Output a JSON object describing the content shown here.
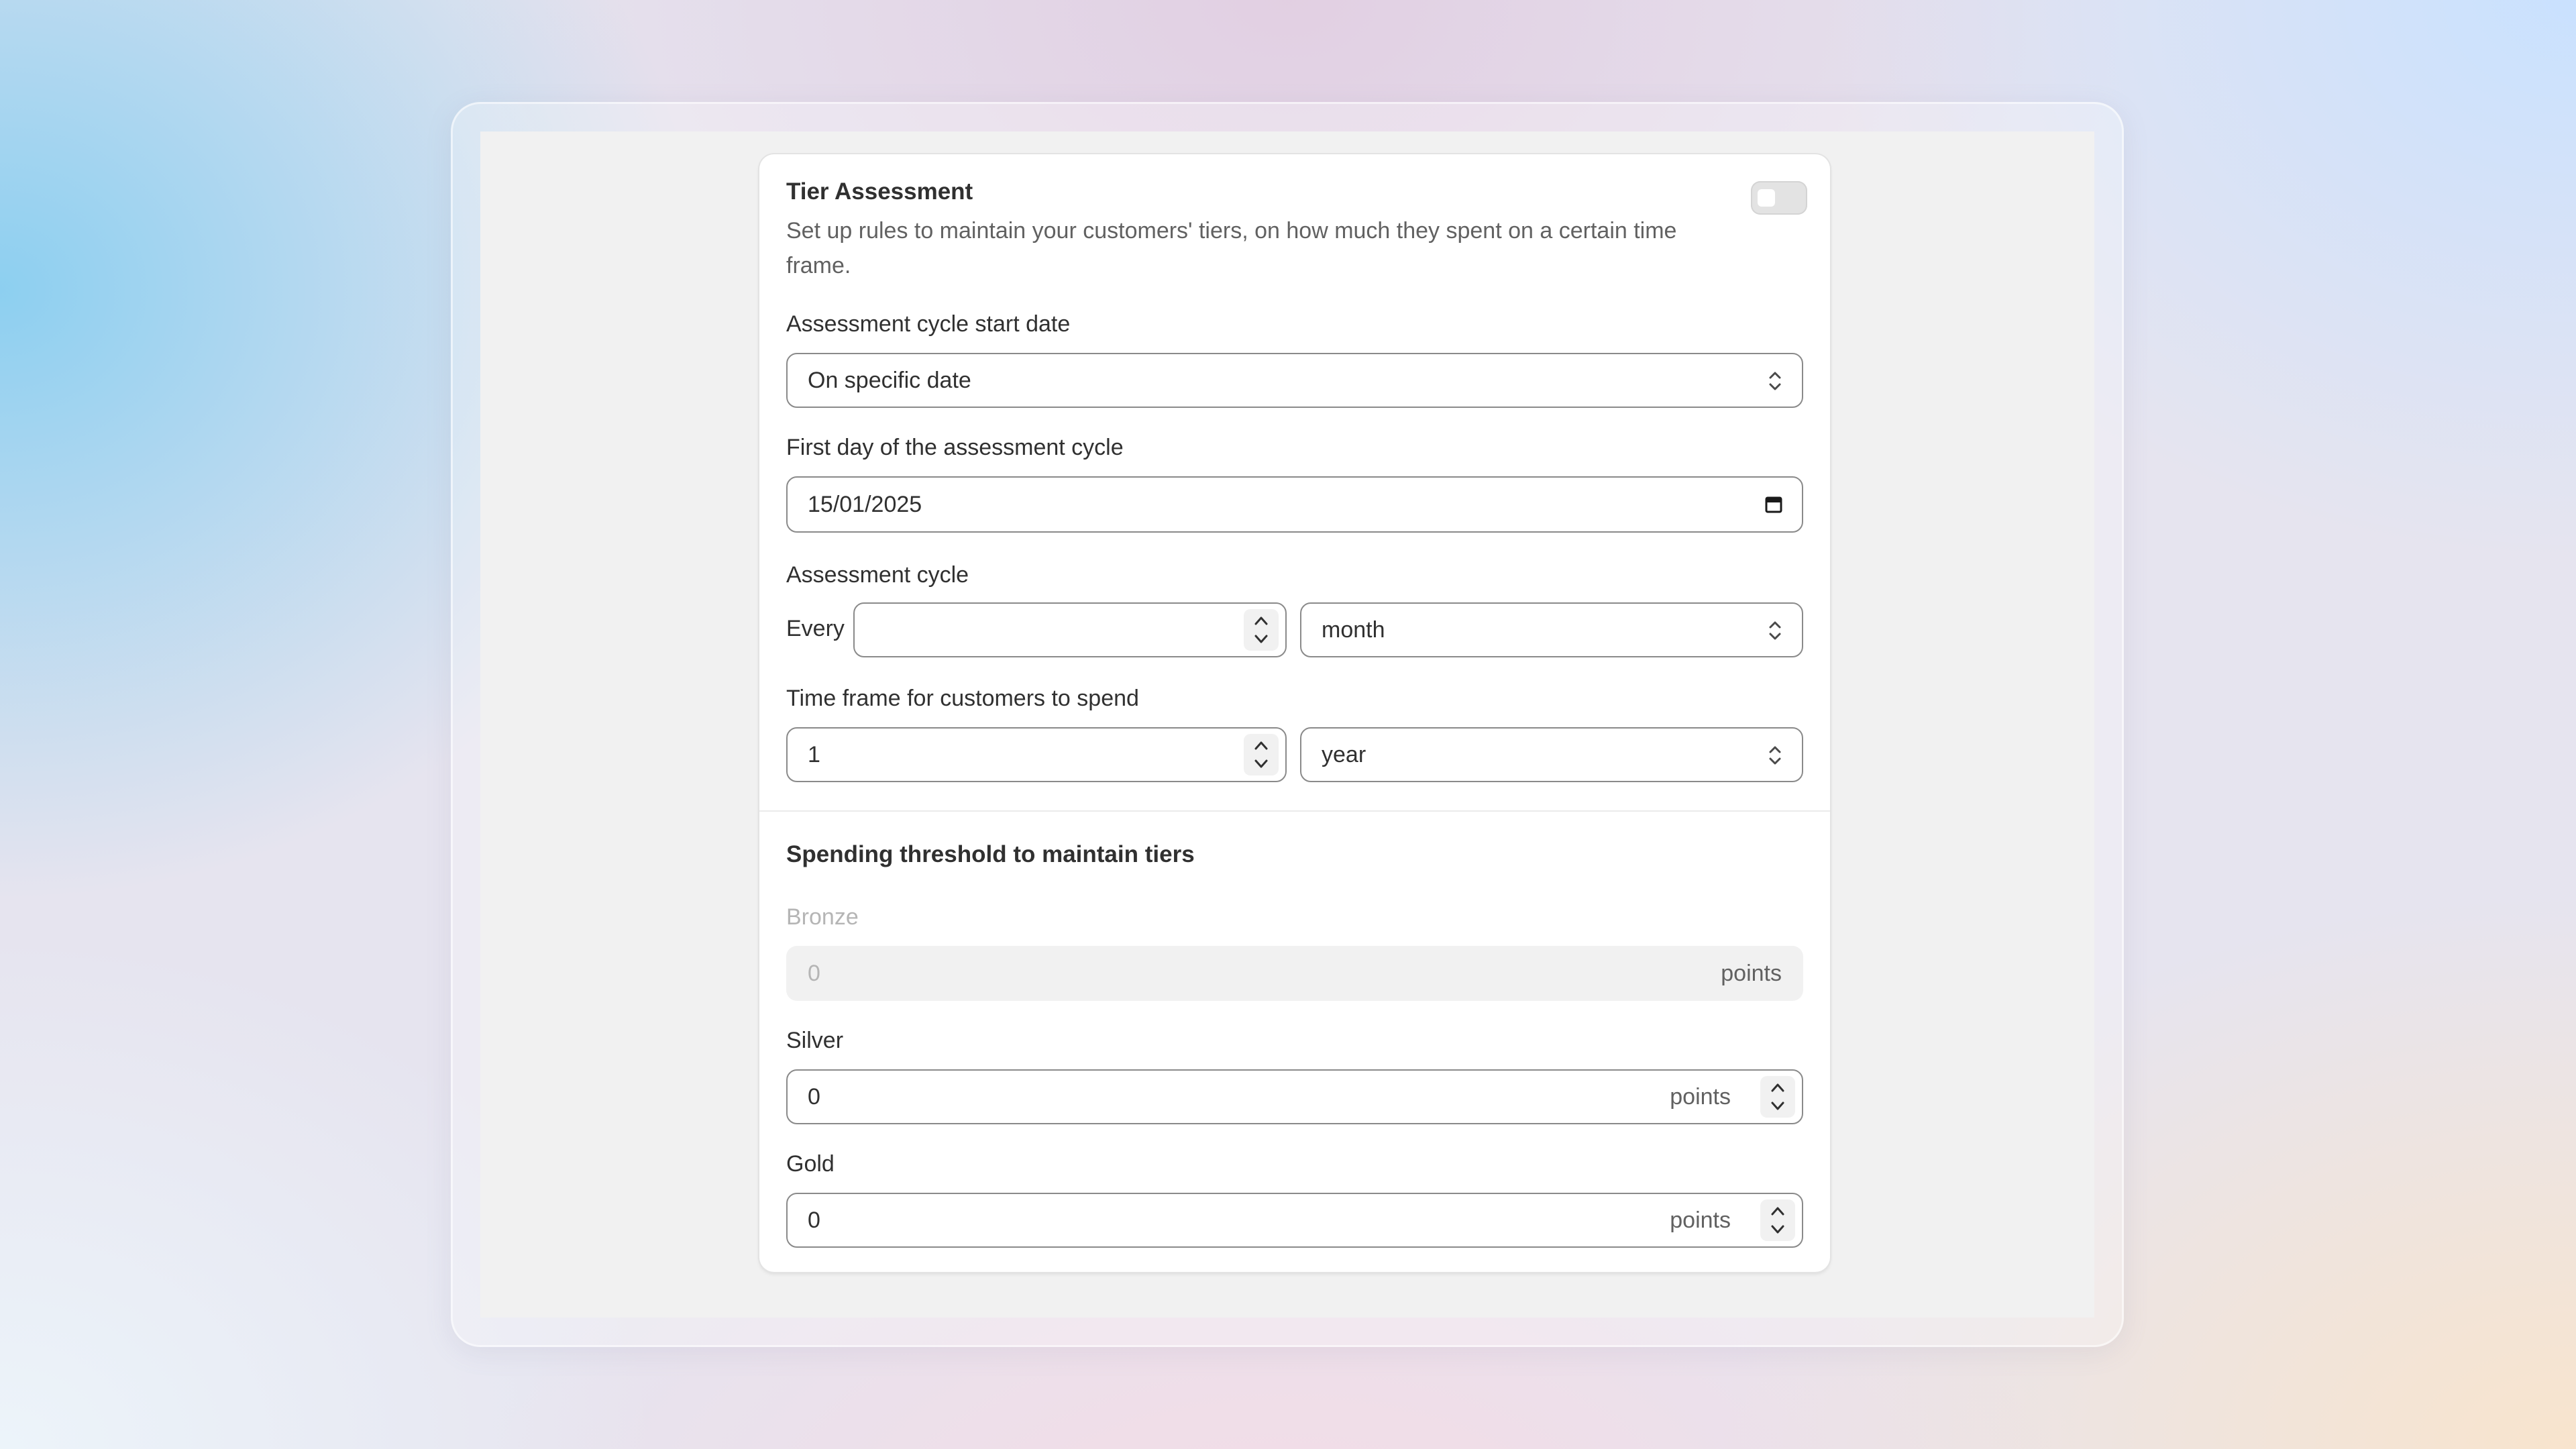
{
  "card": {
    "title": "Tier Assessment",
    "description": "Set up rules to maintain your customers' tiers, on how much they spent on a certain time frame.",
    "enabled": false
  },
  "cycle_start": {
    "label": "Assessment cycle start date",
    "selected": "On specific date"
  },
  "first_day": {
    "label": "First day of the assessment cycle",
    "value": "15/01/2025"
  },
  "assessment_cycle": {
    "label": "Assessment cycle",
    "prefix": "Every",
    "value": "",
    "unit": "month"
  },
  "time_frame": {
    "label": "Time frame for customers to spend",
    "value": "1",
    "unit": "year"
  },
  "thresholds": {
    "heading": "Spending threshold to maintain tiers",
    "suffix": "points",
    "tiers": [
      {
        "label": "Bronze",
        "value": "0",
        "disabled": true
      },
      {
        "label": "Silver",
        "value": "0",
        "disabled": false
      },
      {
        "label": "Gold",
        "value": "0",
        "disabled": false
      }
    ]
  },
  "icons": {
    "select": "select-chevrons-icon",
    "calendar": "calendar-icon",
    "stepper": "stepper-arrows-icon"
  }
}
